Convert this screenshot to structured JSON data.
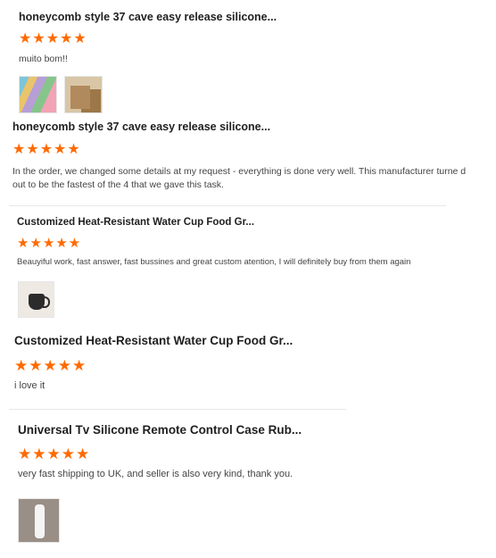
{
  "star_color": "#ff6a00",
  "reviews": [
    {
      "title": "honeycomb style 37 cave easy release silicone...",
      "stars": "★★★★★",
      "rating": 5,
      "text": "muito bom!!",
      "photos": [
        "colorful-molds-photo",
        "cardboard-boxes-photo"
      ]
    },
    {
      "title": "honeycomb style 37 cave easy release silicone...",
      "stars": "★★★★★",
      "rating": 5,
      "text": "In the order, we changed some details at my request - everything is done very well. This manufacturer turne d out to be the fastest of the 4 that we gave this task.",
      "photos": []
    },
    {
      "title": "Customized Heat-Resistant Water Cup Food Gr...",
      "stars": "★★★★★",
      "rating": 5,
      "text": "Beauyiful work, fast answer, fast bussines and great custom atention, I will definitely buy from them again",
      "photos": [
        "black-cup-photo"
      ]
    },
    {
      "title": "Customized Heat-Resistant Water Cup Food Gr...",
      "stars": "★★★★★",
      "rating": 5,
      "text": "i love it",
      "photos": []
    },
    {
      "title": "Universal Tv Silicone Remote Control Case Rub...",
      "stars": "★★★★★",
      "rating": 5,
      "text": "very fast shipping to UK, and seller is also very kind, thank you.",
      "photos": [
        "remote-case-photo"
      ]
    }
  ]
}
